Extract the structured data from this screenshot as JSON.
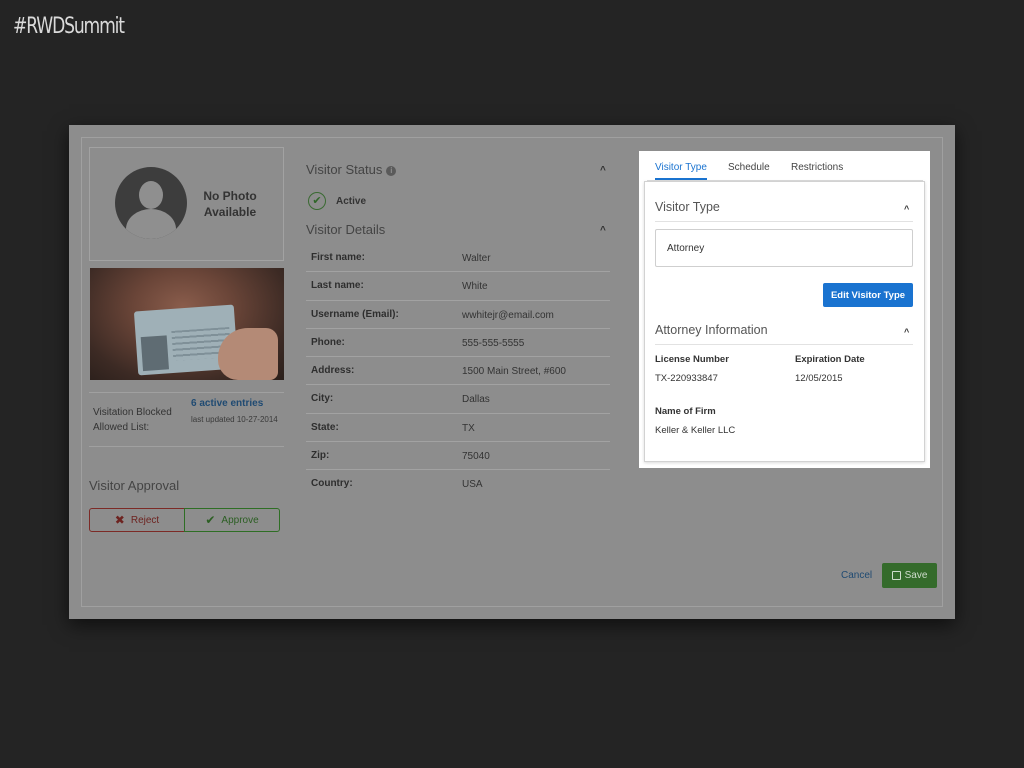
{
  "slide": {
    "hashtag": "#RWDSummit"
  },
  "photo": {
    "placeholder": "No Photo Available"
  },
  "visitation": {
    "label": "Visitation Blocked Allowed List:",
    "entries_link": "6 active entries",
    "last_updated": "last updated 10-27-2014"
  },
  "approval": {
    "title": "Visitor Approval",
    "reject_label": "Reject",
    "approve_label": "Approve"
  },
  "status": {
    "title": "Visitor Status",
    "value": "Active"
  },
  "details": {
    "title": "Visitor Details",
    "rows": [
      {
        "label": "First name:",
        "value": "Walter"
      },
      {
        "label": "Last name:",
        "value": "White"
      },
      {
        "label": "Username (Email):",
        "value": "wwhitejr@email.com"
      },
      {
        "label": "Phone:",
        "value": "555-555-5555"
      },
      {
        "label": "Address:",
        "value": "1500 Main Street, #600"
      },
      {
        "label": "City:",
        "value": "Dallas"
      },
      {
        "label": "State:",
        "value": "TX"
      },
      {
        "label": "Zip:",
        "value": "75040"
      },
      {
        "label": "Country:",
        "value": "USA"
      }
    ]
  },
  "footer": {
    "cancel_label": "Cancel",
    "save_label": "Save"
  },
  "panel": {
    "tabs": [
      {
        "label": "Visitor Type",
        "active": true
      },
      {
        "label": "Schedule",
        "active": false
      },
      {
        "label": "Restrictions",
        "active": false
      }
    ],
    "visitor_type": {
      "title": "Visitor Type",
      "value": "Attorney",
      "edit_label": "Edit Visitor Type"
    },
    "attorney": {
      "title": "Attorney Information",
      "license_label": "License Number",
      "license_value": "TX-220933847",
      "expiration_label": "Expiration Date",
      "expiration_value": "12/05/2015",
      "firm_label": "Name of Firm",
      "firm_value": "Keller & Keller LLC"
    }
  },
  "colors": {
    "accent_blue": "#1a73d0",
    "save_green": "#346b2b",
    "reject_red": "#7c2a26",
    "approve_green": "#2e6e24",
    "slide_background": "#242424"
  }
}
